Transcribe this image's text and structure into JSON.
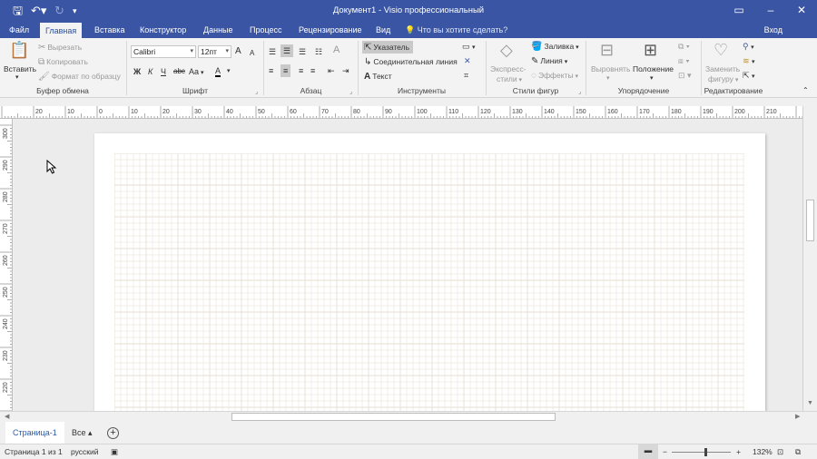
{
  "window": {
    "title": "Документ1 - Visio профессиональный",
    "minimize": "–",
    "restore": "❐",
    "close": "✕"
  },
  "quick_access": {
    "save_icon": "save-icon",
    "undo_icon": "undo-icon",
    "redo_icon": "redo-icon"
  },
  "tabs": [
    {
      "label": "Файл"
    },
    {
      "label": "Главная",
      "active": true
    },
    {
      "label": "Вставка"
    },
    {
      "label": "Конструктор"
    },
    {
      "label": "Данные"
    },
    {
      "label": "Процесс"
    },
    {
      "label": "Рецензирование"
    },
    {
      "label": "Вид"
    }
  ],
  "tell_me": "Что вы хотите сделать?",
  "sign_in": "Вход",
  "ribbon": {
    "clipboard": {
      "label": "Буфер обмена",
      "paste": "Вставить",
      "cut": "Вырезать",
      "copy": "Копировать",
      "format_painter": "Формат по образцу"
    },
    "font": {
      "label": "Шрифт",
      "family": "Calibri",
      "size": "12пт",
      "bold": "Ж",
      "italic": "К",
      "underline": "Ч",
      "strike": "abc",
      "case": "Aa",
      "font_color": "A",
      "grow": "A",
      "shrink": "A"
    },
    "paragraph": {
      "label": "Абзац"
    },
    "tools": {
      "label": "Инструменты",
      "pointer": "Указатель",
      "connector": "Соединительная линия",
      "text": "Текст"
    },
    "shape_styles": {
      "label": "Стили фигур",
      "quick_styles": "Экспресс-",
      "quick_styles_2": "стили",
      "fill": "Заливка",
      "line": "Линия",
      "effects": "Эффекты"
    },
    "arrange": {
      "label": "Упорядочение",
      "align": "Выровнять",
      "position": "Положение"
    },
    "editing": {
      "label": "Редактирование",
      "change_shape": "Заменить",
      "change_shape_2": "фигуру"
    }
  },
  "ruler": {
    "h_labels": [
      "20",
      "10",
      "0",
      "10",
      "20",
      "30",
      "40",
      "50",
      "60",
      "70",
      "80",
      "90",
      "100",
      "110",
      "120",
      "130",
      "140",
      "150",
      "160",
      "170",
      "180",
      "190",
      "200",
      "210"
    ],
    "v_labels": [
      "300",
      "290",
      "280",
      "270",
      "260",
      "250",
      "240",
      "230",
      "220"
    ]
  },
  "page_tabs": {
    "page": "Страница-1",
    "all": "Все ▴",
    "add": "+"
  },
  "status": {
    "page_info": "Страница 1 из 1",
    "language": "русский",
    "zoom": "132%",
    "zoom_minus": "−",
    "zoom_plus": "+"
  },
  "colors": {
    "title_bar": "#3955a3",
    "ribbon": "#f3f3f3",
    "grid_line": "#e6dfd3"
  }
}
